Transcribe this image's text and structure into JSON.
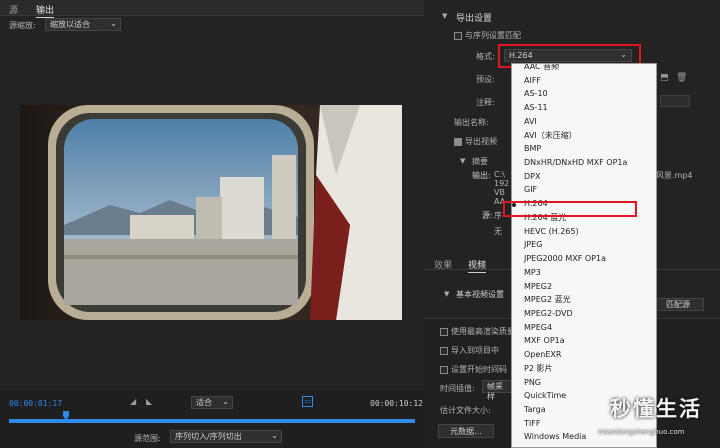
{
  "source_panel": {
    "tabs": [
      "源",
      "输出"
    ],
    "active_tab": "输出",
    "source_scaling_label": "源缩放:",
    "source_scaling_value": "缩放以适合"
  },
  "timeline": {
    "current_time": "00:00:01:17",
    "fit_value": "适合",
    "end_time": "00:00:10:12",
    "range_label": "源范围:",
    "range_value": "序列切入/序列切出",
    "playhead_fraction": 0.14
  },
  "export_settings": {
    "section_title": "导出设置",
    "match_sequence_label": "与序列设置匹配",
    "format_label": "格式:",
    "format_value": "H.264",
    "preset_label": "预设:",
    "comment_label": "注释:",
    "output_name_label": "输出名称:",
    "output_name_value": "风景.mp4",
    "export_video_label": "导出视频",
    "summary_title": "摘要",
    "output_label": "输出:",
    "output_lines": [
      "C:\\",
      "192",
      "VB",
      "AA"
    ],
    "source_label": "源:",
    "source_lines": [
      "序",
      "无"
    ]
  },
  "effects_tabs": {
    "tabs": [
      "效果",
      "视频"
    ],
    "active_tab": "视频",
    "basic_video_label": "基本视频设置",
    "match_source_button": "匹配源"
  },
  "bottom_options": {
    "max_render_label": "使用最高渲染质量",
    "import_label": "导入到项目中",
    "set_start_label": "设置开始时间码",
    "interpolation_label": "时间插值:",
    "interpolation_value": "帧采样",
    "file_size_label": "估计文件大小:",
    "metadata_button": "元数据..."
  },
  "format_menu": {
    "items": [
      "AAC 音频",
      "AIFF",
      "AS-10",
      "AS-11",
      "AVI",
      "AVI（未压缩）",
      "BMP",
      "DNxHR/DNxHD MXF OP1a",
      "DPX",
      "GIF",
      "H.264",
      "H.264 蓝光",
      "HEVC (H.265)",
      "JPEG",
      "JPEG2000 MXF OP1a",
      "MP3",
      "MPEG2",
      "MPEG2 蓝光",
      "MPEG2-DVD",
      "MPEG4",
      "MXF OP1a",
      "OpenEXR",
      "P2 影片",
      "PNG",
      "QuickTime",
      "Targa",
      "TIFF",
      "Windows Media"
    ],
    "selected": "H.264"
  },
  "watermark": {
    "title": "秒懂生活",
    "url": "miaodongshenghuo.com"
  },
  "colors": {
    "accent_blue": "#2d8ceb",
    "highlight_red": "#e0151f",
    "panel_bg": "#232323"
  }
}
